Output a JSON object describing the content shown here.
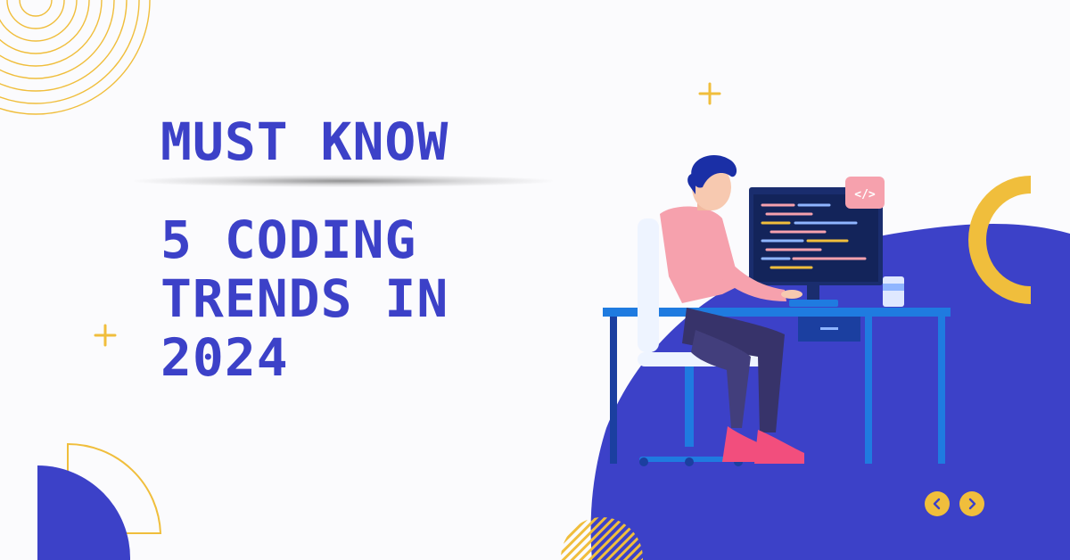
{
  "heading": {
    "top": "MUST KNOW",
    "lines": [
      "5 CODING",
      "TRENDS IN",
      "2024"
    ]
  },
  "illustration": {
    "code_badge": "</>"
  },
  "colors": {
    "primary": "#3c41c8",
    "accent": "#f0be3c",
    "background": "#fbfbfd",
    "pink": "#f6a1ad",
    "desk": "#1f7be0"
  },
  "icons": {
    "prev": "chevron-left-icon",
    "next": "chevron-right-icon"
  }
}
